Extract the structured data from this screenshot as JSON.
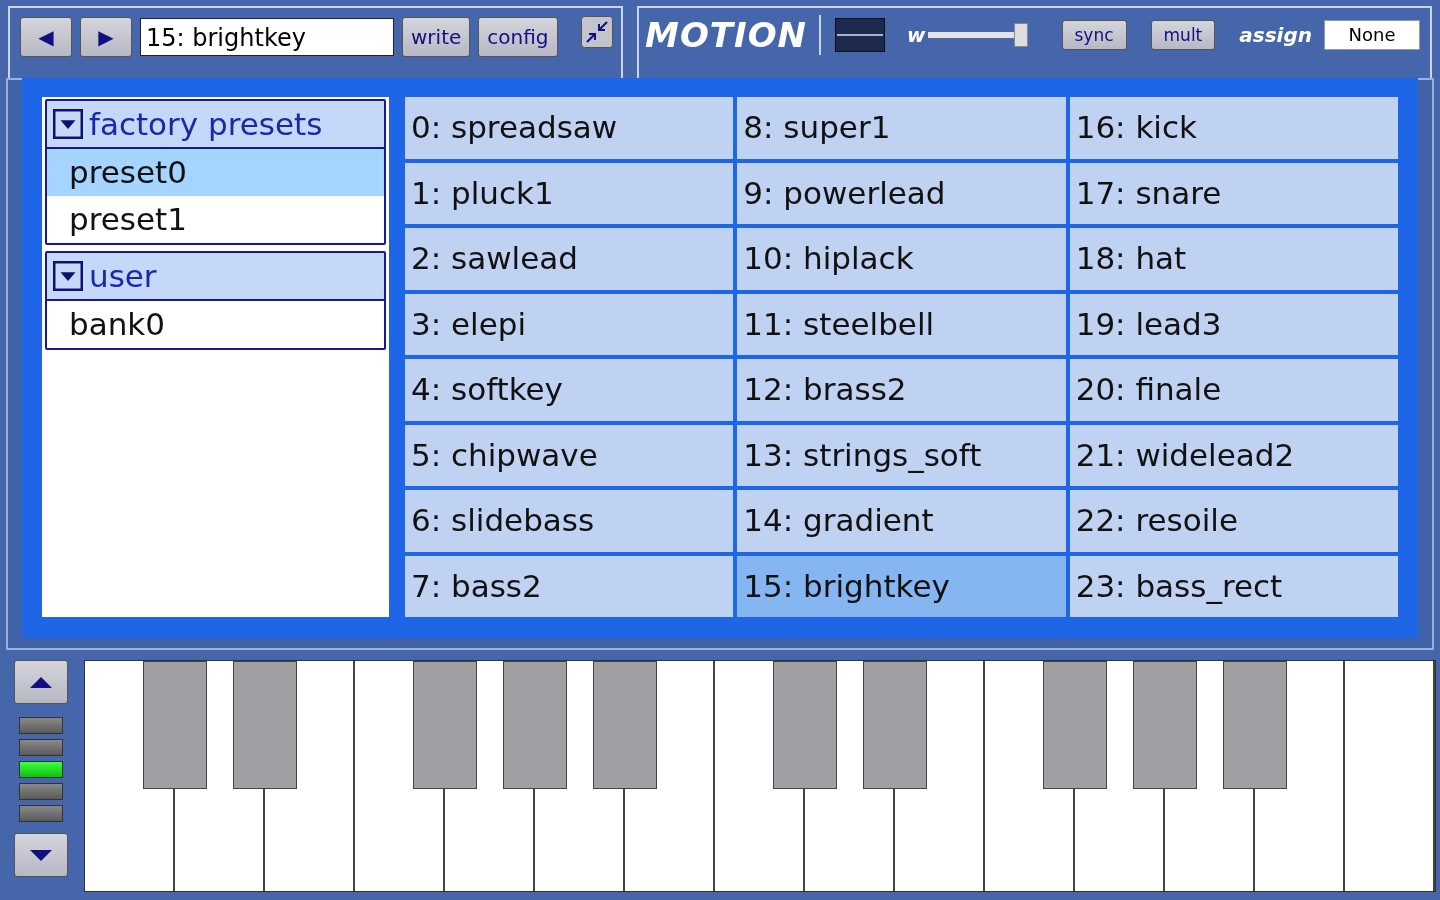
{
  "preset_bar": {
    "prev_button": "◀",
    "next_button": "▶",
    "preset_name": "15: brightkey",
    "buttons": [
      "write",
      "config"
    ]
  },
  "motion": {
    "title": "MOTION",
    "width_label": "w",
    "width_slider": {
      "level": 1.0
    },
    "buttons": [
      "sync",
      "mult"
    ],
    "assign_label": "assign",
    "assign_value": "None"
  },
  "preset_browser": {
    "tree": [
      {
        "label": "factory presets",
        "expanded": true,
        "children": [
          {
            "label": "preset0",
            "selected": true
          },
          {
            "label": "preset1",
            "selected": false
          }
        ]
      },
      {
        "label": "user",
        "expanded": true,
        "children": [
          {
            "label": "bank0",
            "selected": false
          }
        ]
      }
    ],
    "presets": [
      {
        "label": "0: spreadsaw",
        "selected": false
      },
      {
        "label": "1: pluck1",
        "selected": false
      },
      {
        "label": "2: sawlead",
        "selected": false
      },
      {
        "label": "3: elepi",
        "selected": false
      },
      {
        "label": "4: softkey",
        "selected": false
      },
      {
        "label": "5: chipwave",
        "selected": false
      },
      {
        "label": "6: slidebass",
        "selected": false
      },
      {
        "label": "7: bass2",
        "selected": false
      },
      {
        "label": "8: super1",
        "selected": false
      },
      {
        "label": "9: powerlead",
        "selected": false
      },
      {
        "label": "10: hiplack",
        "selected": false
      },
      {
        "label": "11: steelbell",
        "selected": false
      },
      {
        "label": "12: brass2",
        "selected": false
      },
      {
        "label": "13: strings_soft",
        "selected": false
      },
      {
        "label": "14: gradient",
        "selected": false
      },
      {
        "label": "15: brightkey",
        "selected": true
      },
      {
        "label": "16: kick",
        "selected": false
      },
      {
        "label": "17: snare",
        "selected": false
      },
      {
        "label": "18: hat",
        "selected": false
      },
      {
        "label": "19: lead3",
        "selected": false
      },
      {
        "label": "20: finale",
        "selected": false
      },
      {
        "label": "21: widelead2",
        "selected": false
      },
      {
        "label": "22: resoile",
        "selected": false
      },
      {
        "label": "23: bass_rect",
        "selected": false
      }
    ]
  },
  "octave": {
    "leds": [
      {
        "on": false
      },
      {
        "on": false
      },
      {
        "on": true
      },
      {
        "on": false
      },
      {
        "on": false
      }
    ]
  }
}
